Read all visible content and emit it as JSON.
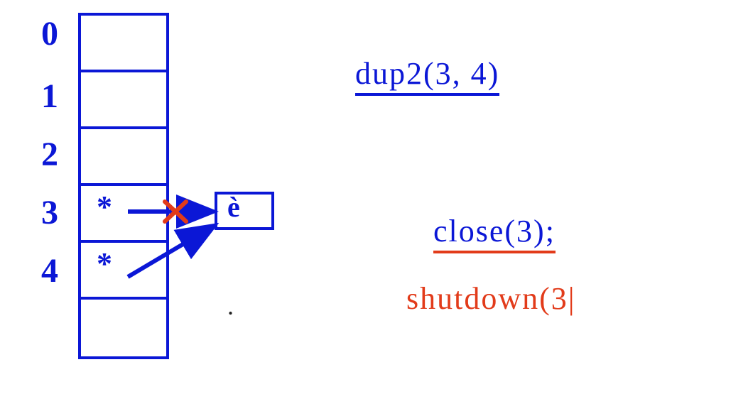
{
  "fd_table": {
    "indices": [
      "0",
      "1",
      "2",
      "3",
      "4"
    ],
    "cell3_mark": "*",
    "cell4_mark": "*"
  },
  "target_box_mark": "è",
  "statements": {
    "dup2": "dup2(3, 4)",
    "close": "close(3);",
    "shutdown": "shutdown(3|"
  },
  "period": "."
}
